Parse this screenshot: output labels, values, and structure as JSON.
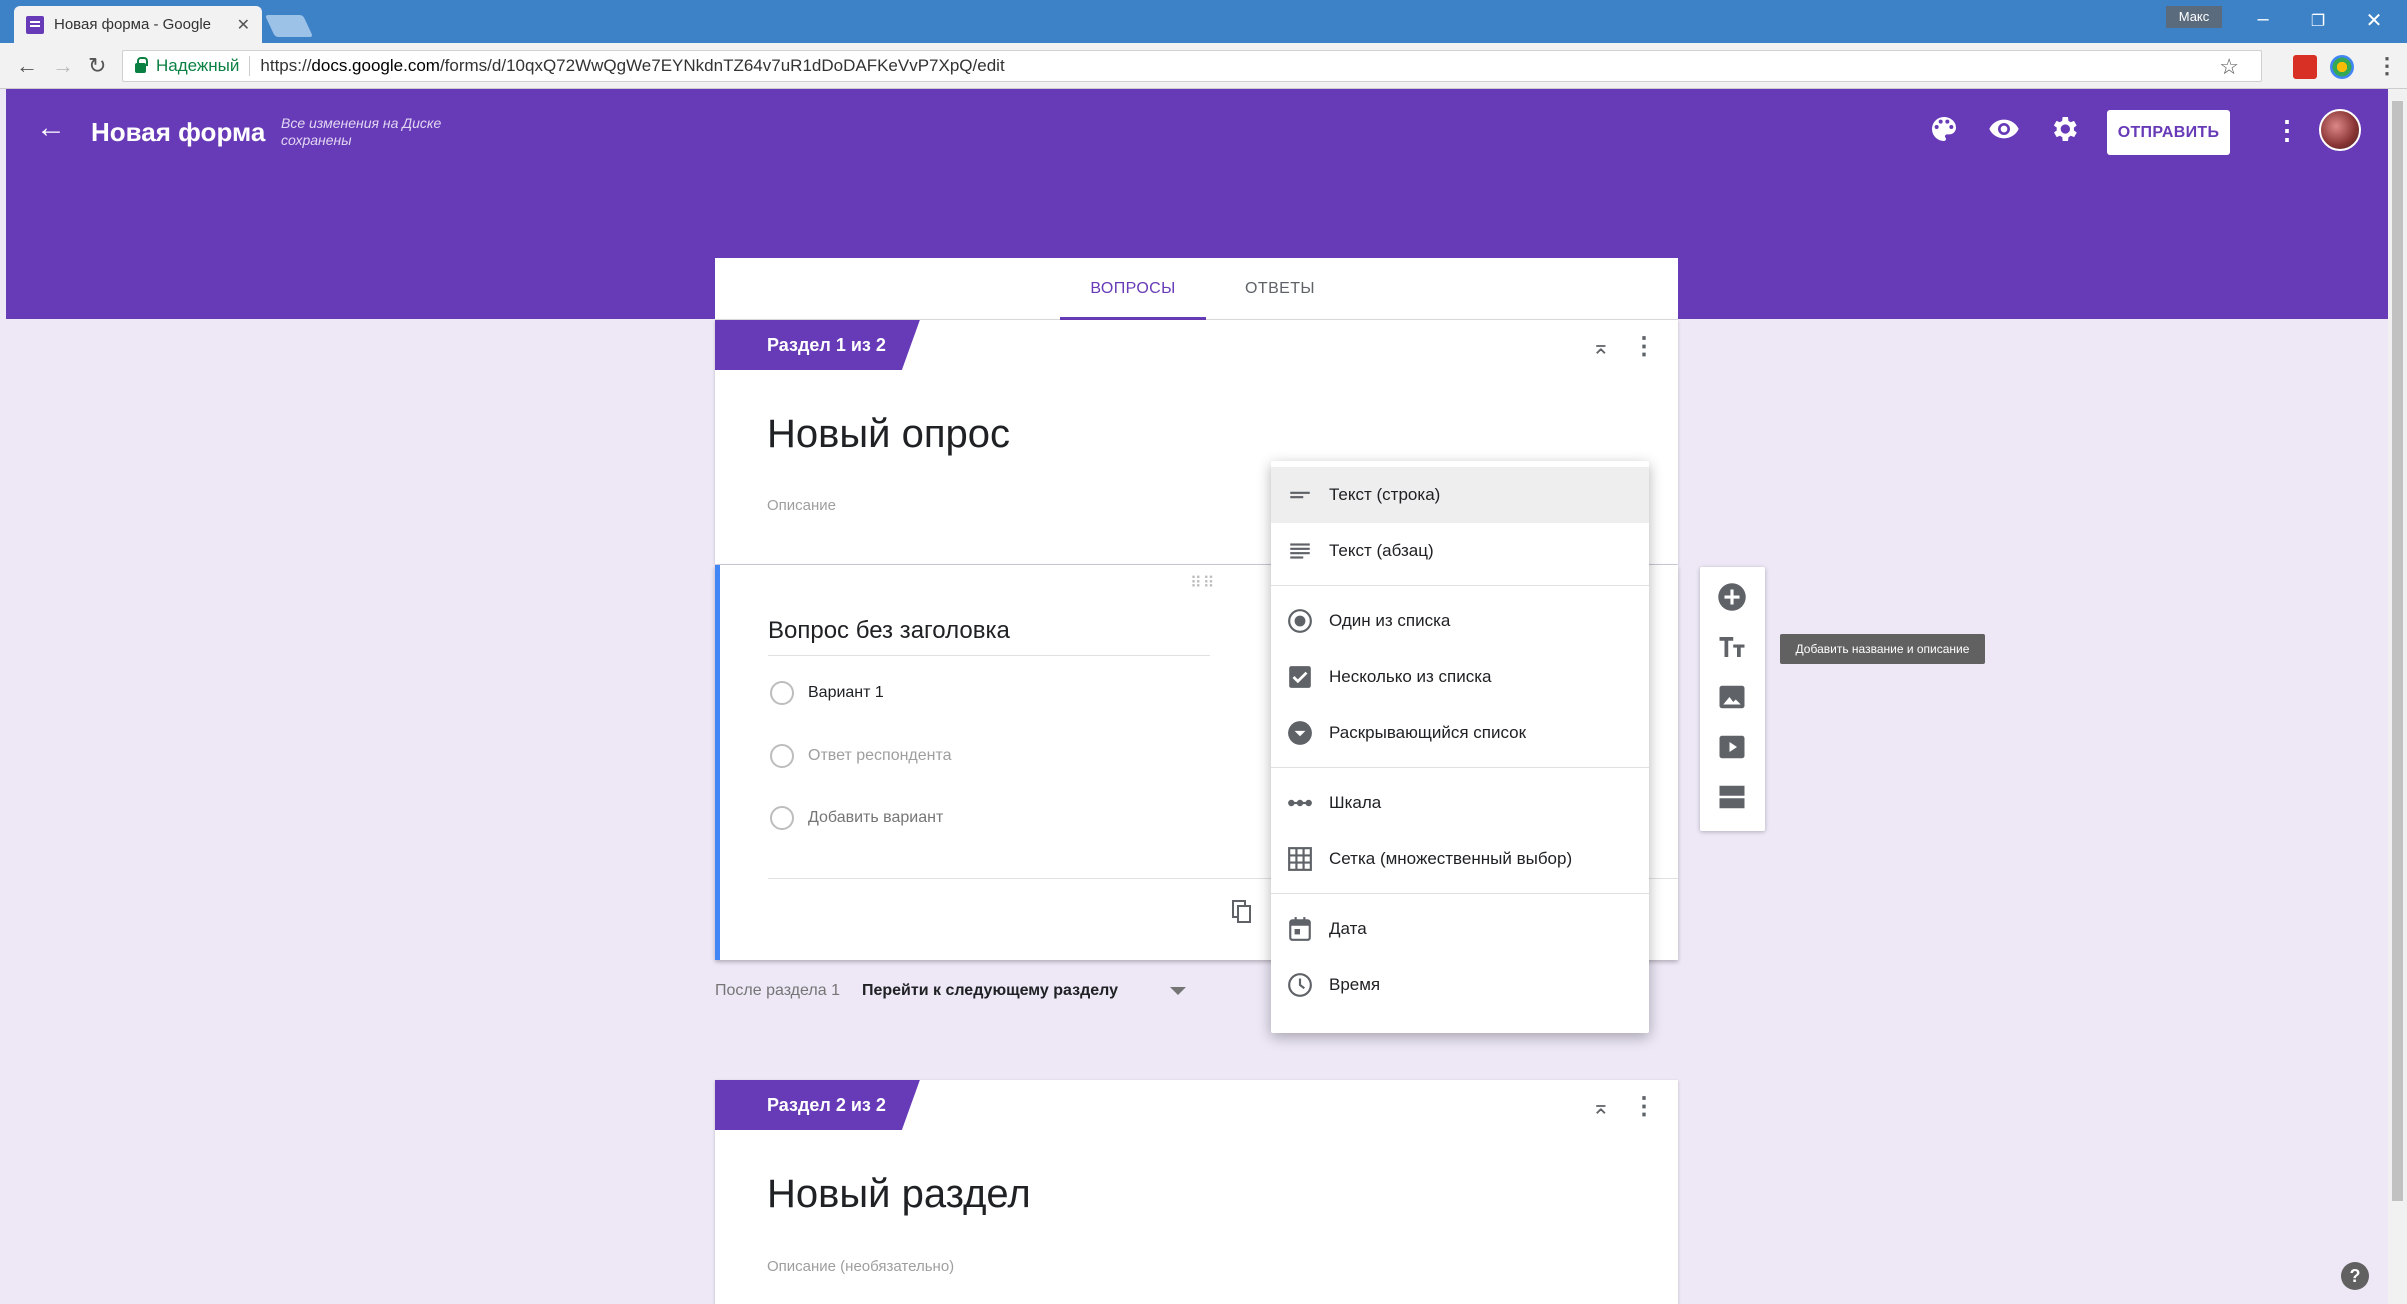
{
  "browser": {
    "tab_title": "Новая форма - Google",
    "tab_close": "✕",
    "profile_name": "Макс",
    "secure_label": "Надежный",
    "url_scheme": "https://",
    "url_host": "docs.google.com",
    "url_path": "/forms/d/10qxQ72WwQgWe7EYNkdnTZ64v7uR1dDoDAFKeVvP7XpQ/edit"
  },
  "header": {
    "form_name": "Новая форма",
    "save_status": "Все изменения на Диске сохранены",
    "send_label": "ОТПРАВИТЬ"
  },
  "tabs": {
    "questions": "ВОПРОСЫ",
    "responses": "ОТВЕТЫ"
  },
  "section1": {
    "tag": "Раздел 1 из 2",
    "title": "Новый опрос",
    "description": "Описание"
  },
  "question": {
    "title": "Вопрос без заголовка",
    "options": [
      "Вариант 1",
      "Ответ респондента",
      "Добавить вариант"
    ]
  },
  "after_section": {
    "label": "После раздела 1",
    "value": "Перейти к следующему разделу"
  },
  "type_menu": {
    "items": [
      {
        "label": "Текст (строка)",
        "icon": "short-text-icon"
      },
      {
        "label": "Текст (абзац)",
        "icon": "paragraph-icon"
      },
      {
        "label": "Один из списка",
        "icon": "radio-icon"
      },
      {
        "label": "Несколько из списка",
        "icon": "checkbox-icon"
      },
      {
        "label": "Раскрывающийся список",
        "icon": "dropdown-icon"
      },
      {
        "label": "Шкала",
        "icon": "linear-scale-icon"
      },
      {
        "label": "Сетка (множественный выбор)",
        "icon": "grid-icon"
      },
      {
        "label": "Дата",
        "icon": "calendar-icon"
      },
      {
        "label": "Время",
        "icon": "clock-icon"
      }
    ]
  },
  "side_toolbar": {
    "tooltip": "Добавить название и описание"
  },
  "section2": {
    "tag": "Раздел 2 из 2",
    "title": "Новый раздел",
    "description": "Описание (необязательно)"
  },
  "colors": {
    "brand": "#673ab7",
    "background": "#ede7f6",
    "focus": "#4285f4"
  }
}
